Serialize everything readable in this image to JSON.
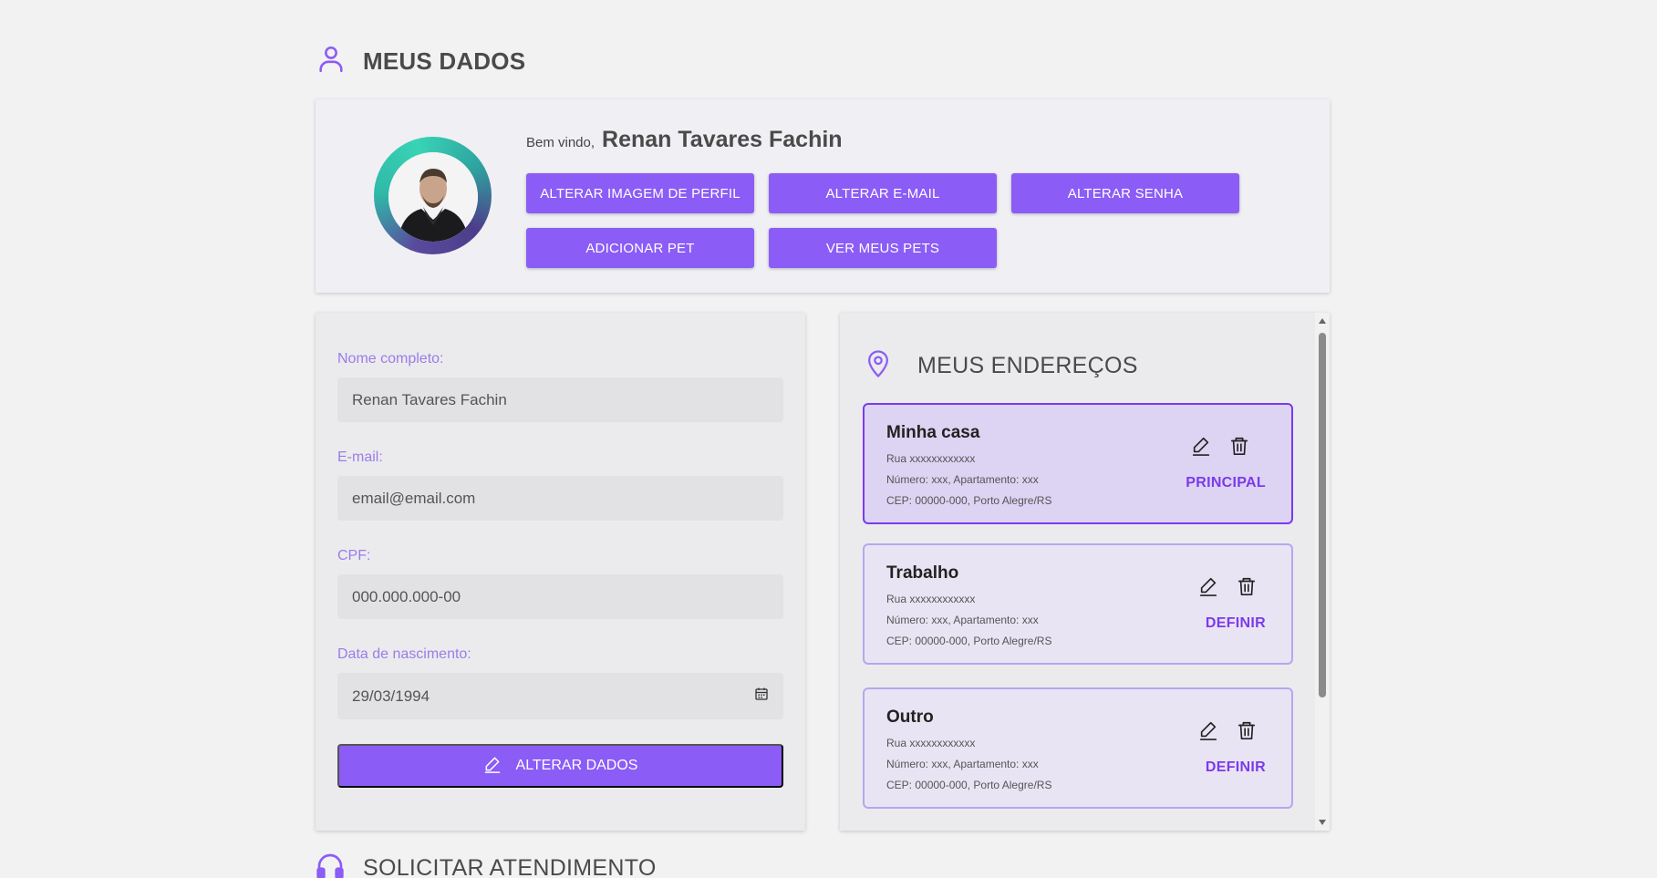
{
  "page": {
    "title": "MEUS DADOS",
    "accent": "#8b5cf6"
  },
  "profile": {
    "welcome": "Bem vindo,",
    "name": "Renan Tavares Fachin",
    "buttons": {
      "change_image": "ALTERAR IMAGEM DE PERFIL",
      "change_email": "ALTERAR E-MAIL",
      "change_password": "ALTERAR SENHA",
      "add_pet": "ADICIONAR PET",
      "view_pets": "VER MEUS PETS"
    }
  },
  "form": {
    "name_label": "Nome completo:",
    "name_value": "Renan Tavares Fachin",
    "email_label": "E-mail:",
    "email_value": "email@email.com",
    "cpf_label": "CPF:",
    "cpf_value": "000.000.000-00",
    "birth_label": "Data de nascimento:",
    "birth_value": "29/03/1994",
    "submit_label": "ALTERAR DADOS"
  },
  "addresses": {
    "title": "MEUS ENDEREÇOS",
    "items": [
      {
        "name": "Minha casa",
        "street": "Rua xxxxxxxxxxxx",
        "number": "Número: xxx, Apartamento: xxx",
        "cep": "CEP: 00000-000, Porto Alegre/RS",
        "action": "PRINCIPAL"
      },
      {
        "name": "Trabalho",
        "street": "Rua xxxxxxxxxxxx",
        "number": "Número: xxx, Apartamento: xxx",
        "cep": "CEP: 00000-000, Porto Alegre/RS",
        "action": "DEFINIR"
      },
      {
        "name": "Outro",
        "street": "Rua xxxxxxxxxxxx",
        "number": "Número: xxx, Apartamento: xxx",
        "cep": "CEP: 00000-000, Porto Alegre/RS",
        "action": "DEFINIR"
      }
    ]
  },
  "support": {
    "title": "SOLICITAR ATENDIMENTO"
  }
}
